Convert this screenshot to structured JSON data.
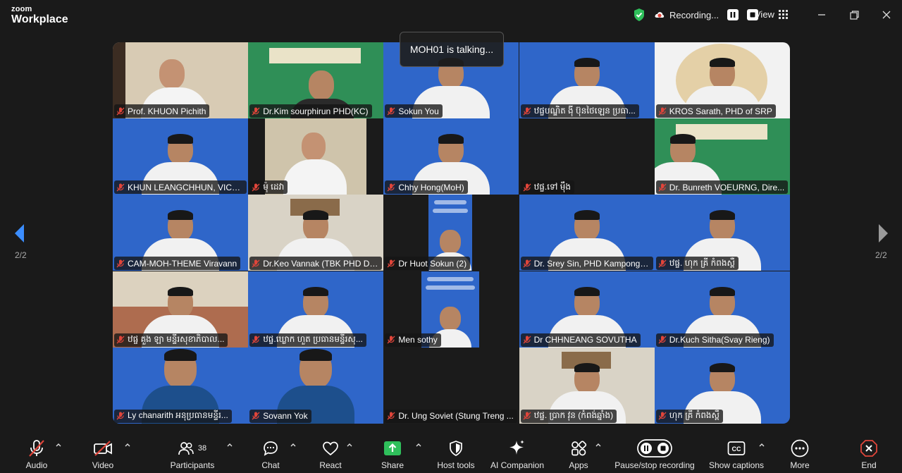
{
  "app": {
    "logo_line1": "zoom",
    "logo_line2": "Workplace",
    "recording_label": "Recording...",
    "view_label": "View"
  },
  "talking_banner": "MOH01 is talking...",
  "pagination": {
    "left": "2/2",
    "right": "2/2"
  },
  "participants": [
    "Prof. KHUON Pichith",
    "Dr.Kim sourphirun PHD(KC)",
    "Sokun You",
    "ឋផ្ចបណ្ឌិត ង៉ី ប៊ុនថៃឡេន ប្រធា...",
    "KROS Sarath, PHD of SRP",
    "KHUN LEANGCHHUN, VICE-...",
    "ម៉ុ ដេវា",
    "Chhy Hong(MoH)",
    "ឋផ្ច.ទៅ ម៉ឹង",
    "Dr. Bunreth VOEURNG, Dire...",
    "CAM-MOH-THEME Viravann",
    "Dr.Keo Vannak (TBK PHD Dir...",
    "Dr Huot Sokun (2)",
    "Dr. Srey Sin, PHD Kampong ...",
    "ឋផ្ច. ហុក គ្រី កំពងស្ពឺ",
    "ឋផ្ច គួង ឡា មន្ទីរសុខាភិបាល...",
    "ឋផ្ច.ឃ្លោក ហួត ប្រធានមន្ទីរសុ...",
    "Men sothy",
    "Dr CHHNEANG SOVUTHA",
    "Dr.Kuch Sitha(Svay Rieng)",
    "Ly chanarith អនុប្រធានមន្ទីរ...",
    "Sovann Yok",
    "Dr. Ung Soviet (Stung Treng ...",
    "ឋផ្ច. ប្រាក វុន (កំពង់ឆ្នាំង)",
    "ហុក គ្រី កំពងស្ពឺ"
  ],
  "toolbar": {
    "audio": "Audio",
    "video": "Video",
    "participants": "Participants",
    "participants_count": "38",
    "chat": "Chat",
    "react": "React",
    "share": "Share",
    "host_tools": "Host tools",
    "ai_companion": "AI Companion",
    "apps": "Apps",
    "pause_stop": "Pause/stop recording",
    "captions": "Show captions",
    "more": "More",
    "end": "End"
  },
  "colors": {
    "background": "#1a1a1a",
    "banner_blue": "#2f66c9",
    "muted_red": "#e0453a",
    "share_green": "#2fbf5b",
    "shield_green": "#2fbf5b"
  }
}
